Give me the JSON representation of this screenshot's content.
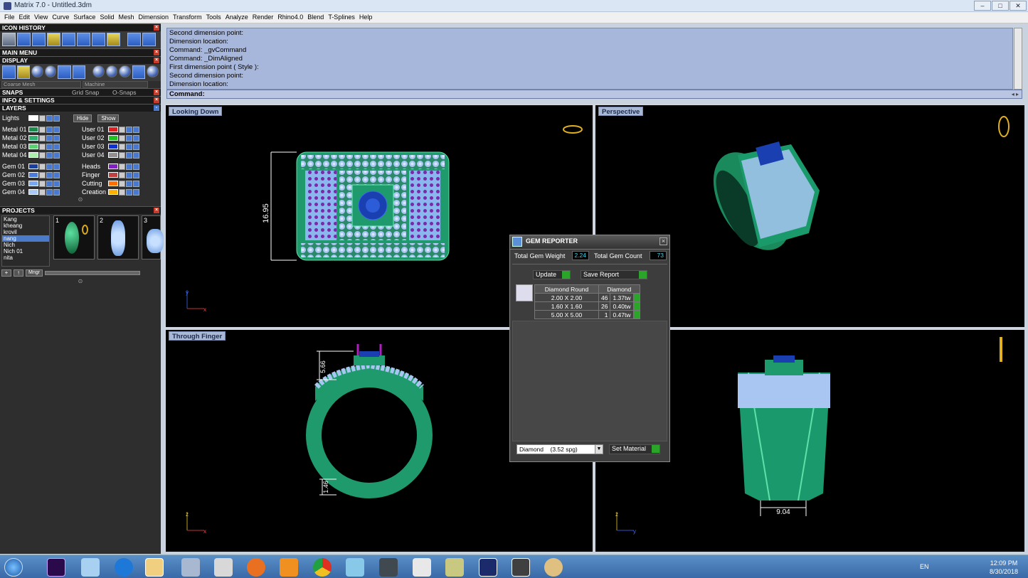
{
  "window": {
    "title": "Matrix 7.0 - Untitled.3dm",
    "buttons": [
      "–",
      "□",
      "✕"
    ]
  },
  "menu": [
    "File",
    "Edit",
    "View",
    "Curve",
    "Surface",
    "Solid",
    "Mesh",
    "Dimension",
    "Transform",
    "Tools",
    "Analyze",
    "Render",
    "Rhino4.0",
    "Blend",
    "T-Splines",
    "Help"
  ],
  "left_panel": {
    "icon_history": "ICON HISTORY",
    "main_menu": "MAIN MENU",
    "display": "DISPLAY",
    "display_mesh": "Coarse Mesh",
    "display_mode": "Machine",
    "snaps": "SNAPS",
    "grid_snap": "Grid Snap",
    "o_snaps": "O-Snaps",
    "info_settings": "INFO & SETTINGS",
    "layers": "LAYERS",
    "lights": "Lights",
    "hide": "Hide",
    "show": "Show",
    "layers_left": [
      {
        "name": "Metal 01",
        "color": "#1c8a4a"
      },
      {
        "name": "Metal 02",
        "color": "#2fb070"
      },
      {
        "name": "Metal 03",
        "color": "#5ad070"
      },
      {
        "name": "Metal 04",
        "color": "#a8f0a8"
      },
      {
        "name": "Gem 01",
        "color": "#1a3fa0"
      },
      {
        "name": "Gem 02",
        "color": "#4a7ae0"
      },
      {
        "name": "Gem 03",
        "color": "#7aa8f0"
      },
      {
        "name": "Gem 04",
        "color": "#a8c8f8"
      }
    ],
    "layers_right": [
      {
        "name": "User 01",
        "color": "#e02020"
      },
      {
        "name": "User 02",
        "color": "#20c020"
      },
      {
        "name": "User 03",
        "color": "#1030d0"
      },
      {
        "name": "User 04",
        "color": "#909090"
      },
      {
        "name": "Heads",
        "color": "#8020c0"
      },
      {
        "name": "Finger",
        "color": "#c04040"
      },
      {
        "name": "Cutting",
        "color": "#ff7000"
      },
      {
        "name": "Creation",
        "color": "#ffb000"
      }
    ],
    "projects_header": "PROJECTS",
    "projects": [
      "Kang",
      "kheang",
      "krovil",
      "nang",
      "Nich",
      "Nich 01",
      "nita"
    ],
    "selected_project": "nang",
    "thumb_numbers": [
      "1",
      "2",
      "3"
    ],
    "mngr": "Mngr"
  },
  "command_history": [
    "Second dimension point:",
    "Dimension location:",
    "Command: _gvCommand",
    "Command: _DimAligned",
    "First dimension point ( Style ):",
    "Second dimension point:",
    "Dimension location:"
  ],
  "command_prompt": "Command:",
  "viewports": {
    "top_left": "Looking Down",
    "top_right": "Perspective",
    "bottom_left": "Through Finger",
    "dim_top": "16.95",
    "dim_side_top": "5.66",
    "dim_side_bottom": "1.46",
    "dim_front": "9.04",
    "axis_y": "y",
    "axis_x": "x",
    "axis_z": "z"
  },
  "gem_reporter": {
    "title": "GEM REPORTER",
    "total_weight_label": "Total Gem Weight",
    "total_weight": "2.24",
    "total_count_label": "Total Gem Count",
    "total_count": "73",
    "update": "Update",
    "save_report": "Save Report",
    "table_headers": [
      "Diamond Round",
      "Diamond"
    ],
    "rows": [
      {
        "size": "2.00 X 2.00",
        "count": "46",
        "weight": "1.37tw"
      },
      {
        "size": "1.60 X 1.60",
        "count": "26",
        "weight": "0.40tw"
      },
      {
        "size": "5.00 X 5.00",
        "count": "1",
        "weight": "0.47tw"
      }
    ],
    "material": "Diamond",
    "material_sg": "(3.52 spg)",
    "set_material": "Set Material"
  },
  "taskbar": {
    "language": "EN",
    "time": "12:09 PM",
    "date": "8/30/2018"
  }
}
